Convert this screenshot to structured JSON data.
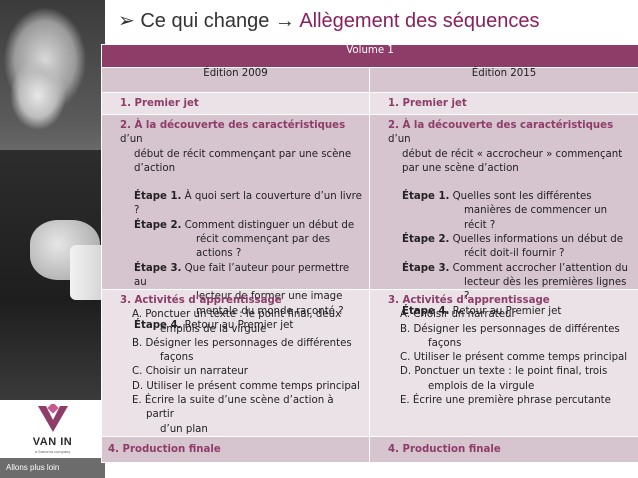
{
  "slide": {
    "title_prefix": "Ce qui change",
    "title_arrow": "→",
    "title_accent": "Allègement des séquences"
  },
  "brand": {
    "logo_text": "VAN IN",
    "logo_sub": "a Sanoma company",
    "slogan": "Allons plus loin",
    "accent_color": "#8d3d68"
  },
  "table": {
    "volume": "Volume 1",
    "col_2009": "Édition 2009",
    "col_2015": "Édition 2015",
    "row1": {
      "left": "1. Premier jet",
      "right": "1. Premier jet"
    },
    "row2": {
      "left": {
        "heading_bold": "2. À la découverte des caractéristiques",
        "heading_rest": " d’un",
        "heading_line2": "début de récit commençant par une scène",
        "heading_line3": "d’action",
        "steps": [
          {
            "label": "Étape 1.",
            "text": " À quoi sert la couverture d’un livre ?",
            "cont": []
          },
          {
            "label": "Étape 2.",
            "text": " Comment distinguer un début de",
            "cont": [
              "récit commençant par des actions ?"
            ]
          },
          {
            "label": "Étape 3.",
            "text": " Que fait l’auteur pour permettre au",
            "cont": [
              "lecteur de former une image",
              "mentale du monde raconté ?"
            ]
          },
          {
            "label": "Étape 4.",
            "text": " Retour au Premier jet",
            "cont": []
          }
        ]
      },
      "right": {
        "heading_bold": "2. À la découverte des caractéristiques",
        "heading_rest": " d’un",
        "heading_line2": "début de récit « accrocheur » commençant",
        "heading_line3": "par une scène d’action",
        "steps": [
          {
            "label": "Étape 1.",
            "text": " Quelles sont les différentes",
            "cont": [
              "manières de commencer un récit ?"
            ]
          },
          {
            "label": "Étape 2.",
            "text": " Quelles informations un début de",
            "cont": [
              "récit doit-il fournir ?"
            ]
          },
          {
            "label": "Étape 3.",
            "text": " Comment accrocher l’attention du",
            "cont": [
              "lecteur dès les premières lignes ?"
            ]
          },
          {
            "label": "Étape 4.",
            "text": " Retour au Premier jet",
            "cont": []
          }
        ]
      }
    },
    "row3": {
      "left": {
        "heading": "3. Activités d’apprentissage",
        "items": [
          {
            "text": "A. Ponctuer un texte : le point final, deux",
            "cont": "emplois de la virgule"
          },
          {
            "text": "B. Désigner les personnages de différentes",
            "cont": "façons"
          },
          {
            "text": "C. Choisir un narrateur",
            "cont": ""
          },
          {
            "text": "D. Utiliser le présent comme temps principal",
            "cont": ""
          },
          {
            "text": "E. Écrire la suite d’une scène d’action à partir",
            "cont": "d’un plan"
          }
        ]
      },
      "right": {
        "heading": "3. Activités d’apprentissage",
        "items": [
          {
            "text": "A. Choisir un narrateur",
            "cont": ""
          },
          {
            "text": "B. Désigner les personnages de différentes",
            "cont": "façons"
          },
          {
            "text": "C. Utiliser le présent comme temps principal",
            "cont": ""
          },
          {
            "text": "D. Ponctuer un texte : le point final, trois",
            "cont": "emplois de la virgule"
          },
          {
            "text": "E. Écrire une première phrase percutante",
            "cont": ""
          }
        ]
      }
    },
    "row4": {
      "left": "4. Production finale",
      "right": "4. Production finale"
    }
  }
}
